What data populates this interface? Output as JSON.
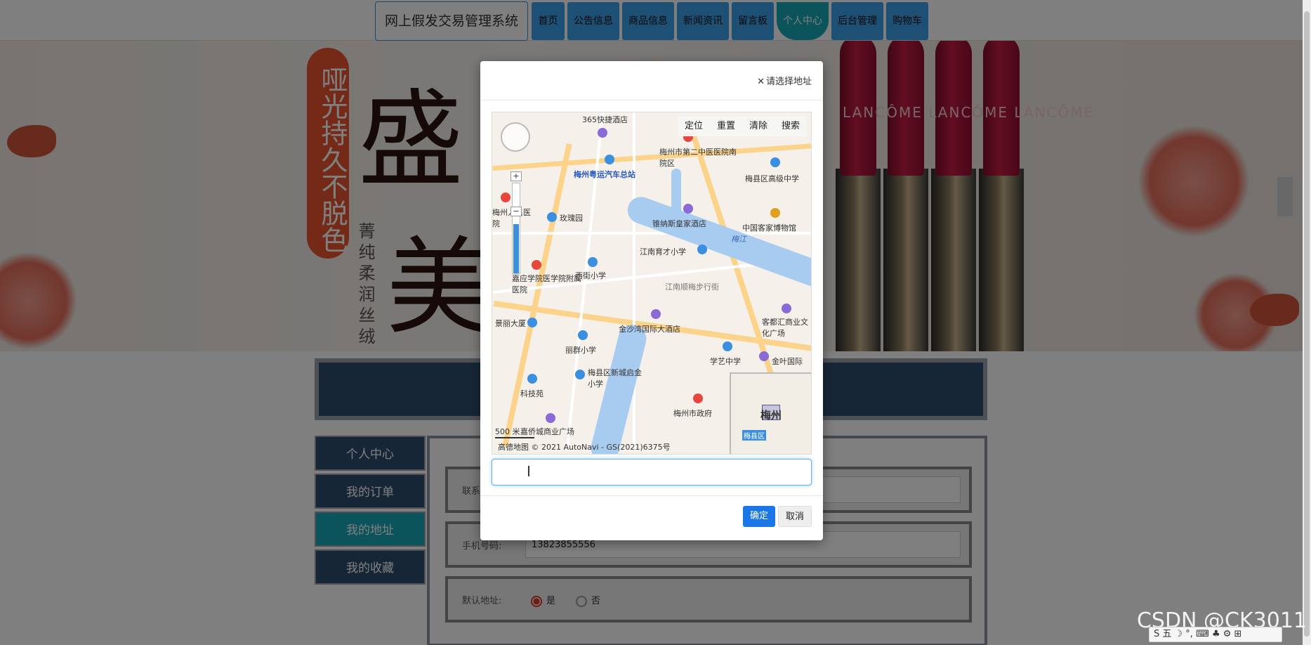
{
  "site": {
    "title": "网上假发交易管理系统"
  },
  "nav": {
    "items": [
      {
        "label": "首页",
        "active": false
      },
      {
        "label": "公告信息",
        "active": false
      },
      {
        "label": "商品信息",
        "active": false
      },
      {
        "label": "新闻资讯",
        "active": false
      },
      {
        "label": "留言板",
        "active": false
      },
      {
        "label": "个人中心",
        "active": true
      },
      {
        "label": "后台管理",
        "active": false
      },
      {
        "label": "购物车",
        "active": false
      }
    ]
  },
  "banner": {
    "pill_text": "哑光持久不脱色",
    "big_char_1": "盛",
    "big_char_2": "美",
    "vertical_text": "菁纯柔润丝绒",
    "lipstick_text": "LANCÔME LANCÔME LANCÔME"
  },
  "sidebar": {
    "items": [
      {
        "label": "个人中心",
        "active": false
      },
      {
        "label": "我的订单",
        "active": false
      },
      {
        "label": "我的地址",
        "active": true
      },
      {
        "label": "我的收藏",
        "active": false
      }
    ]
  },
  "form": {
    "contact_label": "联系",
    "phone_label": "手机号码:",
    "phone_value": "13823855556",
    "default_label": "默认地址:",
    "default_yes": "是",
    "default_no": "否",
    "default_selected": "是"
  },
  "modal": {
    "title": "请选择地址",
    "close_glyph": "✕",
    "map_toolbar": [
      "定位",
      "重置",
      "清除",
      "搜索"
    ],
    "map_labels": {
      "p1": "365快捷酒店",
      "p2": "梅州市第二中医医院南院区",
      "p3": "梅县区高级中学",
      "p4": "梅州粤运汽车总站",
      "p5": "玫瑰园",
      "p6": "锥纳斯皇家酒店",
      "p7": "中国客家博物馆",
      "p8": "江南育才小学",
      "p9": "西街小学",
      "p10": "江南顺梅步行街",
      "p11": "嘉应学院医学院附属医院",
      "p12": "客都汇商业文化广场",
      "p13": "金沙湾国际大酒店",
      "p14": "丽群小学",
      "p15": "学艺中学",
      "p16": "金叶国际",
      "p17": "梅县区新城启金小学",
      "p18": "科技苑",
      "p19": "梅州市政府",
      "p20": "嘉侨城商业广场",
      "p21": "景丽大厦",
      "p22": "梅州人民医院",
      "p23": "梅江"
    },
    "minimap": {
      "city": "梅州",
      "district": "梅县区"
    },
    "scale": "500 米",
    "copyright": "高德地图 © 2021 AutoNavi - GS(2021)6375号",
    "address_value": "",
    "confirm_label": "确定",
    "cancel_label": "取消"
  },
  "watermark": "CSDN @CK3011",
  "ime": {
    "text": "S 五 ☽ °, ⌨ ♣ ⚙ ⊞"
  }
}
